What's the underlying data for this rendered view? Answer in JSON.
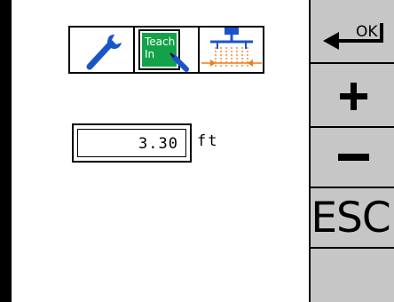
{
  "icon_bar": {
    "icons": [
      {
        "name": "wrench-icon"
      },
      {
        "name": "teach-in-icon",
        "text_line1": "Teach",
        "text_line2": "In"
      },
      {
        "name": "boom-width-icon"
      }
    ]
  },
  "setting": {
    "value": "3.30",
    "unit": "ft"
  },
  "softkeys": {
    "ok_label": "OK",
    "plus_label": "+",
    "minus_label": "−",
    "esc_label": "ESC"
  },
  "colors": {
    "icon_blue": "#1a55c8",
    "teach_green": "#13a24a",
    "key_gray": "#c6c6c6",
    "accent_orange": "#f07a1a"
  }
}
